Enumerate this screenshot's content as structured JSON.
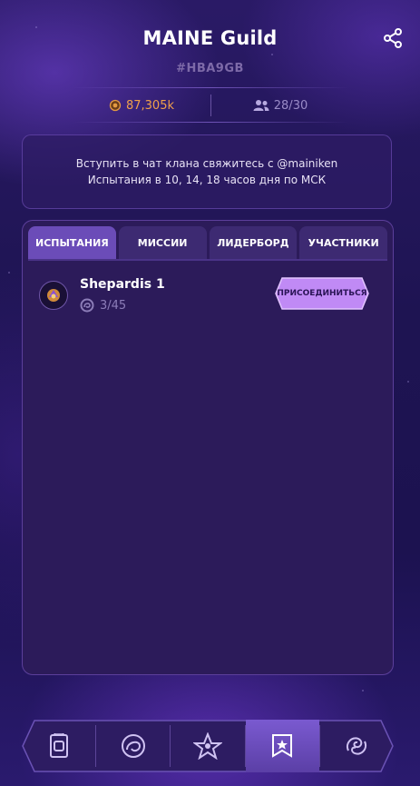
{
  "header": {
    "title": "MAINE Guild",
    "tag": "#HBA9GB",
    "share_icon": "share-icon"
  },
  "stats": {
    "power": "87,305k",
    "power_icon": "coin-icon",
    "members": "28/30",
    "members_icon": "users-icon"
  },
  "info": {
    "line1": "Вступить в чат клана свяжитесь с @mainiken",
    "line2": "Испытания в 10, 14, 18 часов дня по МСК"
  },
  "tabs": [
    {
      "label": "ИСПЫТАНИЯ",
      "active": true
    },
    {
      "label": "МИССИИ",
      "active": false
    },
    {
      "label": "ЛИДЕРБОРД",
      "active": false
    },
    {
      "label": "УЧАСТНИКИ",
      "active": false
    }
  ],
  "trials": [
    {
      "name": "Shepardis 1",
      "progress": "3/45",
      "join_label": "ПРИСОЕДИНИТЬСЯ"
    }
  ],
  "navbar": {
    "items": [
      "cards-icon",
      "portal-icon",
      "star-battle-icon",
      "guild-banner-icon",
      "swirl-icon"
    ],
    "active_index": 3
  },
  "colors": {
    "accent": "#6b4cb8",
    "join_button": "#c08af5",
    "power": "#f0a04b",
    "panel": "#2c1b5a"
  }
}
